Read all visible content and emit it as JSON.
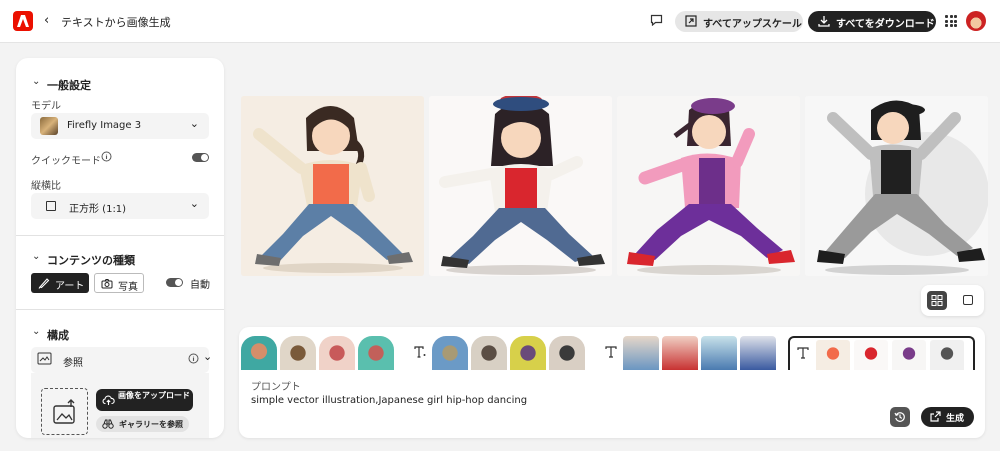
{
  "header": {
    "back_label": "<",
    "title": "テキストから画像生成",
    "upscale_label": "すべてアップスケール",
    "download_label": "すべてをダウンロード"
  },
  "sidebar": {
    "general": {
      "title": "一般設定",
      "model_label": "モデル",
      "model_value": "Firefly Image 3",
      "quick_mode_label": "クイックモード",
      "quick_mode_on": true,
      "aspect_label": "縦横比",
      "aspect_value": "正方形 (1:1)"
    },
    "content_type": {
      "title": "コンテンツの種類",
      "art_label": "アート",
      "photo_label": "写真",
      "auto_label": "自動",
      "auto_on": true
    },
    "composition": {
      "title": "構成",
      "reference_label": "参照",
      "upload_label": "画像をアップロード",
      "gallery_label": "ギャラリーを参照"
    }
  },
  "prompt": {
    "label": "プロンプト",
    "text": "simple  vector  illustration,Japanese girl hip-hop dancing",
    "generate_label": "生成"
  },
  "colors": {
    "brand": "#eb1000",
    "dark_button": "#222222",
    "panel": "#ffffff",
    "background": "#f3f3f3"
  },
  "icons": [
    "adobe-logo-icon",
    "comment-icon",
    "upscale-icon",
    "download-icon",
    "apps-grid-icon",
    "chevron-down-icon",
    "info-icon",
    "square-icon",
    "brush-icon",
    "camera-icon",
    "reference-icon",
    "upload-image-icon",
    "cloud-upload-icon",
    "binoculars-icon",
    "text-style-icon",
    "history-icon",
    "generate-icon",
    "grid-view-icon",
    "single-view-icon"
  ]
}
